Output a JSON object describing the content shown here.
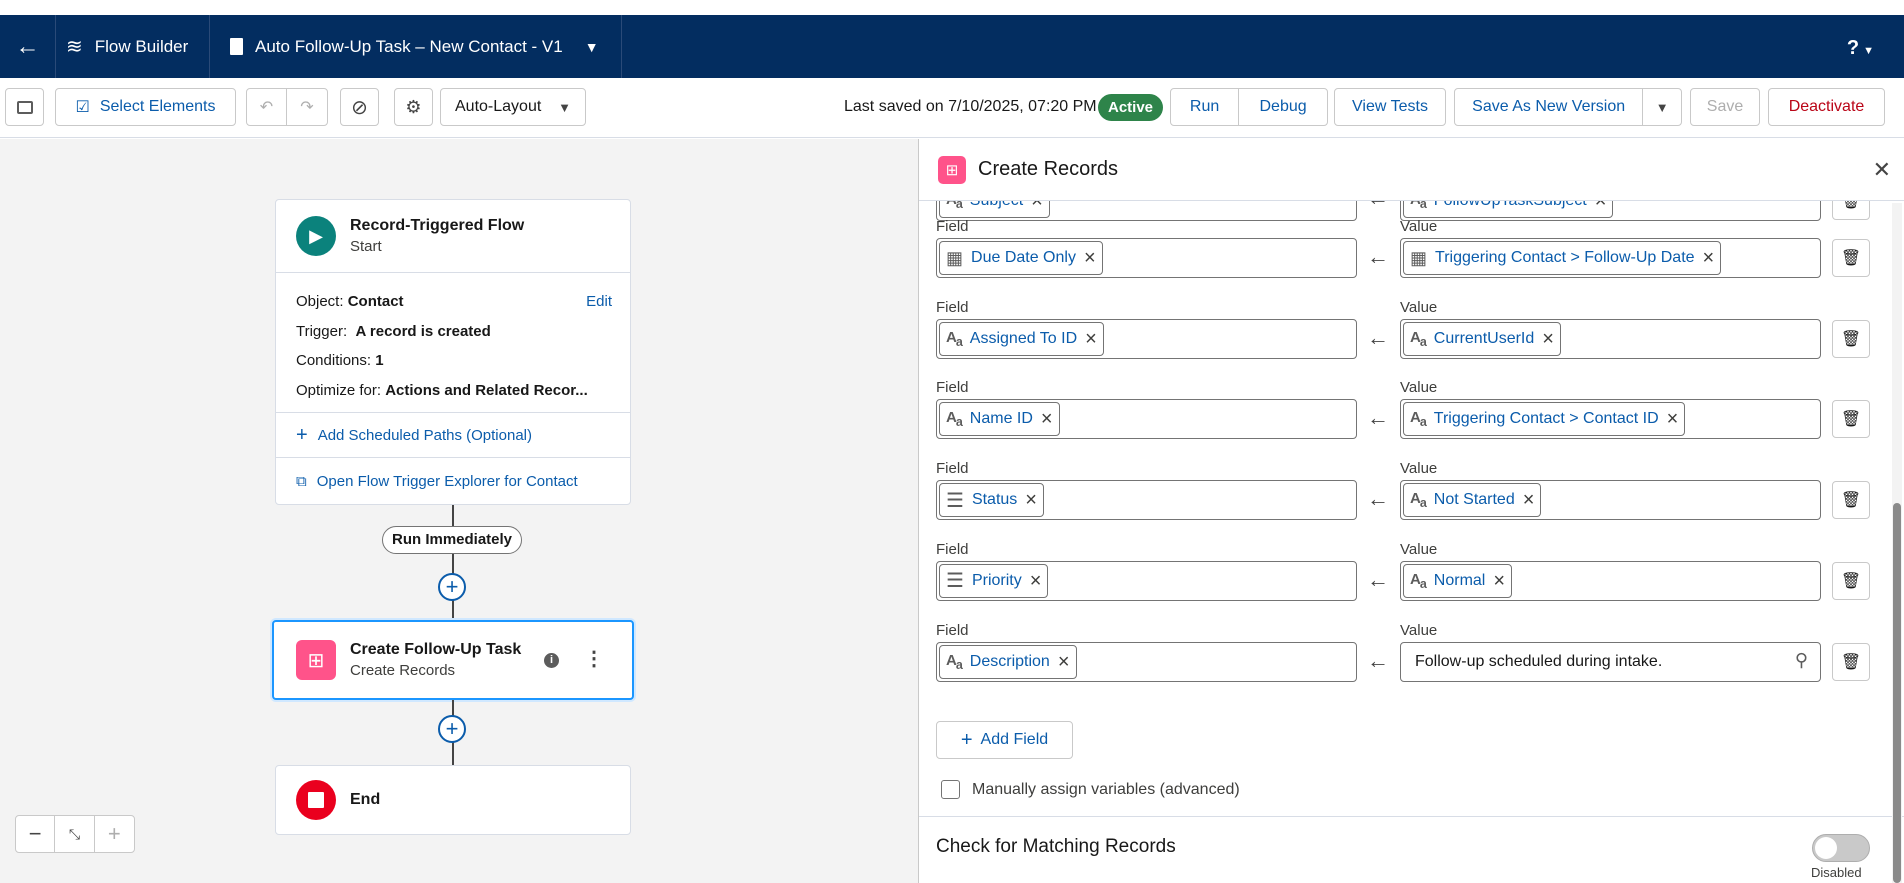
{
  "header": {
    "app_name": "Flow Builder",
    "flow_title": "Auto Follow-Up Task – New Contact - V1",
    "help": "?"
  },
  "toolbar": {
    "select_elements": "Select Elements",
    "layout": "Auto-Layout",
    "last_saved": "Last saved on 7/10/2025, 07:20 PM",
    "status": "Active",
    "run": "Run",
    "debug": "Debug",
    "view_tests": "View Tests",
    "save_as_new": "Save As New Version",
    "save": "Save",
    "deactivate": "Deactivate"
  },
  "start_node": {
    "title": "Record-Triggered Flow",
    "subtitle": "Start",
    "object_label": "Object:",
    "object_value": "Contact",
    "edit": "Edit",
    "trigger_label": "Trigger:",
    "trigger_value": "A record is created",
    "conditions_label": "Conditions:",
    "conditions_value": "1",
    "optimize_label": "Optimize for:",
    "optimize_value": "Actions and Related Recor...",
    "add_paths": "Add Scheduled Paths (Optional)",
    "open_explorer": "Open Flow Trigger Explorer for Contact"
  },
  "path_label": "Run Immediately",
  "task_node": {
    "title": "Create Follow-Up Task",
    "subtitle": "Create Records"
  },
  "end_node": {
    "title": "End"
  },
  "panel": {
    "title": "Create Records",
    "field_label": "Field",
    "value_label": "Value",
    "partial_row": {
      "field": "Subject",
      "value": "FollowUpTaskSubject"
    },
    "rows": [
      {
        "field": "Due Date Only",
        "field_icon": "calendar-icon",
        "value": "Triggering Contact > Follow-Up Date",
        "value_icon": "calendar-icon"
      },
      {
        "field": "Assigned To ID",
        "field_icon": "text-icon",
        "value": "CurrentUserId",
        "value_icon": "text-icon"
      },
      {
        "field": "Name ID",
        "field_icon": "text-icon",
        "value": "Triggering Contact > Contact ID",
        "value_icon": "text-icon"
      },
      {
        "field": "Status",
        "field_icon": "picklist-icon",
        "value": "Not Started",
        "value_icon": "text-icon"
      },
      {
        "field": "Priority",
        "field_icon": "picklist-icon",
        "value": "Normal",
        "value_icon": "text-icon"
      },
      {
        "field": "Description",
        "field_icon": "text-icon",
        "value": "Follow-up scheduled during intake.",
        "value_icon": "search-icon"
      }
    ],
    "add_field": "Add Field",
    "manual_assign": "Manually assign variables (advanced)",
    "matching_title": "Check for Matching Records",
    "toggle_label": "Disabled"
  }
}
